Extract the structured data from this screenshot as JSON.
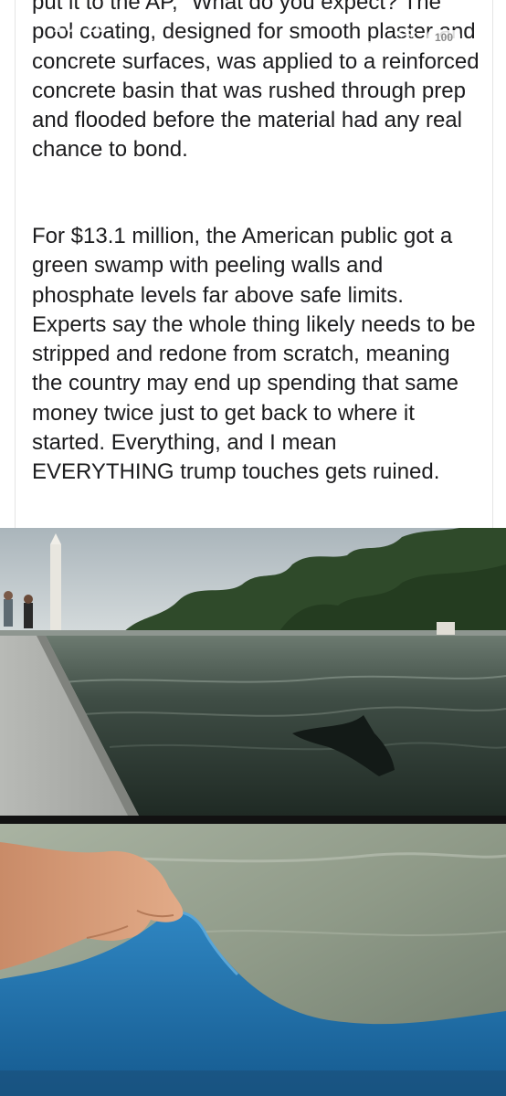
{
  "status_bar": {
    "time": "10:16",
    "back_label": "Safari",
    "battery": "100"
  },
  "post": {
    "paragraphs": [
      "put it to the AP, \"What do you expect? The pool coating, designed for smooth plaster and concrete surfaces, was applied to a reinforced concrete basin that was rushed through prep and flooded before the material had any real chance to bond.",
      "For $13.1 million, the American public got a green swamp with peeling walls and phosphate levels far above safe limits. Experts say the whole thing likely needs to be stripped and redone from scratch, meaning the country may end up spending that same money twice just to get back to where it started. Everything, and I mean EVERYTHING trump touches gets ruined."
    ]
  },
  "colors": {
    "text": "#1c1c1e",
    "water": "#2c3a33",
    "coating": "#1e6fa8",
    "sky": "#c4ccd0"
  }
}
